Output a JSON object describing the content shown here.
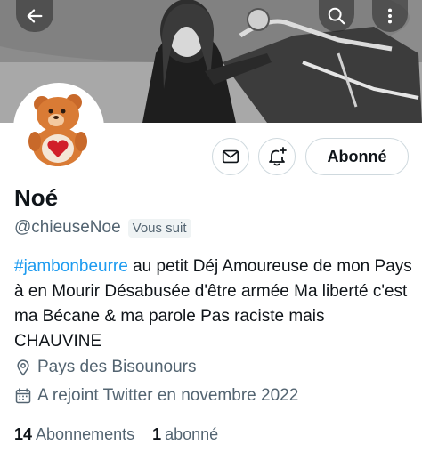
{
  "header": {
    "back_icon": "arrow-left-icon",
    "search_icon": "search-icon",
    "more_icon": "more-vertical-icon",
    "banner_description_icon": "banner-photo"
  },
  "profile": {
    "avatar_icon": "care-bear-avatar",
    "name": "Noé",
    "handle": "@chieuseNoe",
    "follows_you": "Vous suit",
    "follow_button": "Abonné",
    "message_icon": "mail-icon",
    "notify_icon": "bell-plus-icon"
  },
  "bio": {
    "hashtag": "#jambonbeurre",
    "text": " au petit Déj Amoureuse de mon Pays à en Mourir Désabusée d'être armée Ma liberté c'est ma Bécane & ma parole Pas raciste mais CHAUVINE"
  },
  "meta": {
    "location_icon": "location-pin-icon",
    "location": "Pays des Bisounours",
    "calendar_icon": "calendar-icon",
    "joined": "A rejoint Twitter en novembre 2022"
  },
  "stats": {
    "following_count": "14",
    "following_label": "Abonnements",
    "followers_count": "1",
    "followers_label": "abonné"
  },
  "colors": {
    "link": "#1d9bf0",
    "secondary_text": "#536471",
    "primary_text": "#0f1419",
    "border": "#cfd9de"
  }
}
